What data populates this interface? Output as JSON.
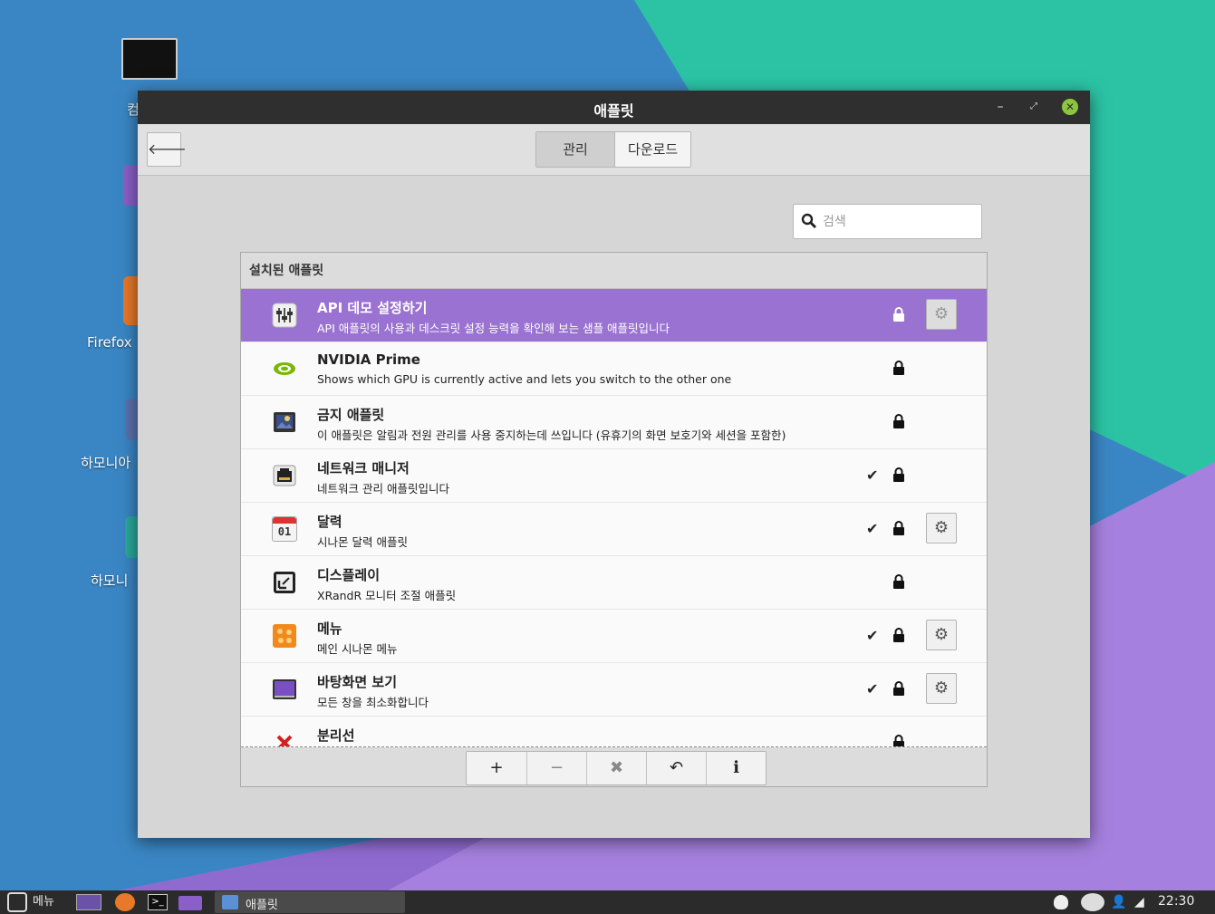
{
  "colors": {
    "selection": "#9a72d1",
    "titlebar": "#2f2f2f",
    "close_button": "#8cc63f",
    "desktop_blue": "#3a86c4",
    "desktop_teal": "#2cc3a5",
    "desktop_purple": "#a580de"
  },
  "desktop": {
    "icons": [
      {
        "label": "컴",
        "icon": "monitor-icon"
      },
      {
        "label": "",
        "icon": "folder-icon"
      },
      {
        "label": "Firefox",
        "icon": "firefox-icon"
      },
      {
        "label": "하모니아",
        "icon": "app-icon"
      },
      {
        "label": "하모니",
        "icon": "app-icon"
      }
    ]
  },
  "window": {
    "title": "애플릿",
    "controls": {
      "minimize": "–",
      "maximize": "⤢",
      "close": "✕"
    }
  },
  "toolbar": {
    "back_icon": "arrow-left-icon",
    "tabs": [
      {
        "label": "관리",
        "active": true
      },
      {
        "label": "다운로드",
        "active": false
      }
    ]
  },
  "search": {
    "placeholder": "검색",
    "value": ""
  },
  "panel": {
    "header": "설치된 애플릿",
    "applets": [
      {
        "name": "API 데모 설정하기",
        "desc": "API 애플릿의 사용과 데스크릿 설정 능력을 확인해 보는 샘플 애플릿입니다",
        "icon": "sliders-icon",
        "enabled": false,
        "locked": true,
        "configurable": true,
        "selected": true
      },
      {
        "name": "NVIDIA Prime",
        "desc": "Shows which GPU is currently active and lets you switch to the other one",
        "icon": "nvidia-icon",
        "enabled": false,
        "locked": true,
        "configurable": false,
        "selected": false
      },
      {
        "name": "금지 애플릿",
        "desc": "이 애플릿은 알림과 전원 관리를 사용 중지하는데 쓰입니다 (유휴기의 화면 보호기와 세션을 포함한)",
        "icon": "inhibit-icon",
        "enabled": false,
        "locked": true,
        "configurable": false,
        "selected": false
      },
      {
        "name": "네트워크 매니저",
        "desc": "네트워크 관리 애플릿입니다",
        "icon": "network-icon",
        "enabled": true,
        "locked": true,
        "configurable": false,
        "selected": false
      },
      {
        "name": "달력",
        "desc": "시나몬 달력 애플릿",
        "icon": "calendar-icon",
        "icon_text": "01",
        "enabled": true,
        "locked": true,
        "configurable": true,
        "selected": false
      },
      {
        "name": "디스플레이",
        "desc": "XRandR 모니터 조절 애플릿",
        "icon": "display-icon",
        "enabled": false,
        "locked": true,
        "configurable": false,
        "selected": false
      },
      {
        "name": "메뉴",
        "desc": "메인 시나몬 메뉴",
        "icon": "menu-icon",
        "enabled": true,
        "locked": true,
        "configurable": true,
        "selected": false
      },
      {
        "name": "바탕화면 보기",
        "desc": "모든 창을 최소화합니다",
        "icon": "show-desktop-icon",
        "enabled": true,
        "locked": true,
        "configurable": true,
        "selected": false
      },
      {
        "name": "분리선",
        "desc": "",
        "icon": "separator-icon",
        "enabled": false,
        "locked": true,
        "configurable": false,
        "selected": false
      }
    ],
    "buttons": [
      {
        "name": "add-button",
        "label": "+",
        "enabled": true
      },
      {
        "name": "remove-button",
        "label": "−",
        "enabled": false
      },
      {
        "name": "uninstall-button",
        "label": "✖",
        "enabled": false
      },
      {
        "name": "restore-button",
        "label": "↶",
        "enabled": true
      },
      {
        "name": "info-button",
        "label": "ℹ",
        "enabled": true
      }
    ]
  },
  "taskbar": {
    "menu_label": "메뉴",
    "window_label": "애플릿",
    "clock": "22:30"
  }
}
